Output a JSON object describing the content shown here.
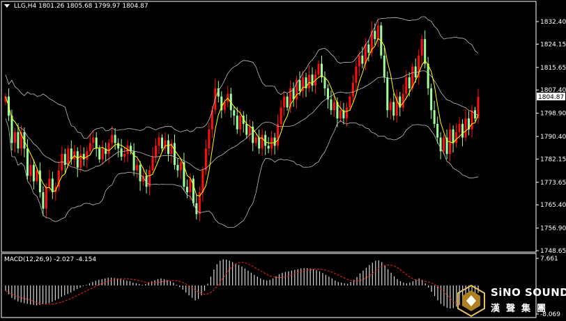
{
  "header": {
    "symbol": "LLG,H4",
    "ohlc": "1801.26 1805.68 1799.97 1804.87"
  },
  "macd_header": {
    "label": "MACD(12,26,9) -2.027 -4.154"
  },
  "watermark": {
    "brand": "SiNO SOUND",
    "brand_cn": "漢聲集團"
  },
  "colors": {
    "up": "#ff1010",
    "down": "#9cff9c",
    "signal_ma": "#ffff00",
    "bands": "#bfbfbf",
    "macd_signal": "#ff2020",
    "macd_hist": "#d8d8d8"
  },
  "chart_data": [
    {
      "type": "candlestick",
      "symbol": "LLG",
      "timeframe": "H4",
      "ylim": [
        1748.65,
        1836.0
      ],
      "y_ticks": [
        1832.4,
        1824.15,
        1815.65,
        1807.4,
        1798.9,
        1790.4,
        1782.15,
        1773.65,
        1765.4,
        1756.9,
        1748.65
      ],
      "current_price": 1804.87,
      "current_price_label": "1804.87",
      "indicators": [
        "Bollinger Bands",
        "Moving Average"
      ],
      "grid": false,
      "close": [
        1805,
        1798,
        1788,
        1792,
        1786,
        1792,
        1786,
        1776,
        1780,
        1774,
        1778,
        1770,
        1764,
        1772,
        1775,
        1770,
        1772,
        1778,
        1784,
        1780,
        1786,
        1782,
        1785,
        1779,
        1784,
        1782,
        1785,
        1788,
        1790,
        1786,
        1782,
        1786,
        1784,
        1788,
        1791,
        1788,
        1786,
        1783,
        1784,
        1787,
        1785,
        1778,
        1780,
        1774,
        1776,
        1772,
        1778,
        1783,
        1787,
        1790,
        1786,
        1789,
        1784,
        1788,
        1780,
        1778,
        1781,
        1772,
        1770,
        1775,
        1766,
        1762,
        1770,
        1778,
        1786,
        1793,
        1800,
        1808,
        1805,
        1800,
        1803,
        1806,
        1800,
        1798,
        1793,
        1798,
        1795,
        1791,
        1794,
        1788,
        1790,
        1786,
        1791,
        1787,
        1786,
        1790,
        1787,
        1795,
        1801,
        1805,
        1801,
        1808,
        1804,
        1811,
        1807,
        1812,
        1808,
        1813,
        1809,
        1813,
        1817,
        1812,
        1808,
        1804,
        1800,
        1803,
        1797,
        1800,
        1797,
        1801,
        1805,
        1810,
        1816,
        1820,
        1817,
        1824,
        1821,
        1829,
        1826,
        1831,
        1820,
        1812,
        1800,
        1803,
        1798,
        1805,
        1801,
        1806,
        1812,
        1808,
        1816,
        1812,
        1820,
        1826,
        1817,
        1808,
        1800,
        1795,
        1790,
        1785,
        1790,
        1784,
        1793,
        1788,
        1792,
        1795,
        1790,
        1797,
        1793,
        1800,
        1797,
        1804.87
      ],
      "high_low_spread": 3
    },
    {
      "type": "macd",
      "params": "12,26,9",
      "macd": -2.027,
      "signal": -4.154,
      "ylim": [
        -8.069,
        7.661
      ],
      "y_ticks": [
        7.661,
        -8.069
      ],
      "y_tick_labels": [
        "7.661",
        "-8.069"
      ],
      "histogram": [
        -1.5,
        -2.5,
        -3.5,
        -4,
        -4.5,
        -4.8,
        -5,
        -5.2,
        -5.4,
        -5.5,
        -5.6,
        -5.5,
        -5.3,
        -5.2,
        -5,
        -4.6,
        -4.2,
        -3.8,
        -3.2,
        -2.8,
        -2.4,
        -2,
        -1.5,
        -1,
        -0.6,
        -0.2,
        0.2,
        0.6,
        1,
        1.3,
        1.6,
        1.8,
        2,
        2.2,
        2.2,
        2.1,
        2,
        1.8,
        1.6,
        1.4,
        1.2,
        0.8,
        0.6,
        0.4,
        0.2,
        0.4,
        0.8,
        1.2,
        1.5,
        1.8,
        2,
        1.8,
        1.5,
        1.2,
        0.8,
        0.2,
        -0.5,
        -1.2,
        -2,
        -2.8,
        -3.5,
        -4.2,
        -3.8,
        -2.8,
        -1.5,
        0.5,
        2.5,
        4.5,
        6,
        7,
        7.4,
        7.3,
        7,
        6.6,
        6.2,
        5.8,
        5.3,
        4.8,
        4.2,
        3.6,
        3,
        2.5,
        2,
        1.6,
        1.4,
        1.6,
        2,
        2.6,
        3.2,
        3.6,
        3.8,
        4,
        4.2,
        4.4,
        4.6,
        4.8,
        4.9,
        4.9,
        4.8,
        4.6,
        4.4,
        4,
        3.5,
        3,
        2.5,
        2,
        1.4,
        1,
        0.8,
        0.6,
        0.5,
        1,
        1.6,
        2.4,
        3.4,
        4.2,
        5,
        5.8,
        6.4,
        7,
        7.1,
        6.6,
        5.6,
        4.6,
        3.6,
        2.6,
        1.8,
        1.2,
        0.8,
        0.6,
        0.8,
        1.2,
        1.6,
        2,
        1.6,
        0.6,
        -0.6,
        -1.8,
        -3,
        -4.2,
        -5.2,
        -5.8,
        -6.3,
        -6.5,
        -6.4,
        -6,
        -5.6,
        -5,
        -4.4,
        -3.8,
        -3.2,
        -2.6,
        -2.1
      ]
    }
  ]
}
